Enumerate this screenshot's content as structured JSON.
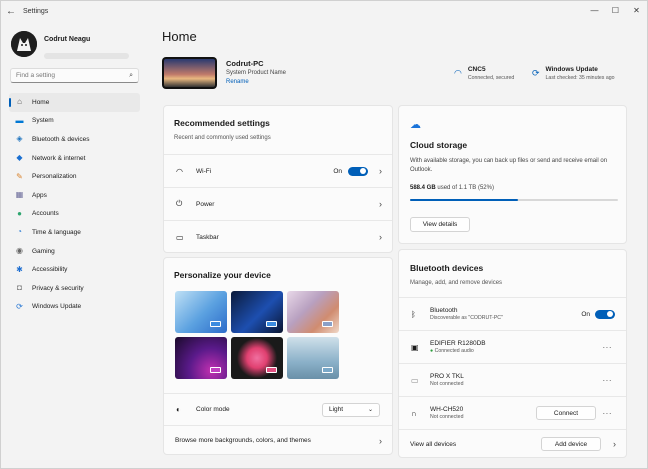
{
  "window": {
    "title": "Settings",
    "minimize": "—",
    "maximize": "☐",
    "close": "✕"
  },
  "profile": {
    "name": "Codrut Neagu"
  },
  "search": {
    "placeholder": "Find a setting"
  },
  "nav": [
    {
      "label": "Home",
      "icon": "home-icon",
      "glyph": "⌂",
      "color": "#555555"
    },
    {
      "label": "System",
      "icon": "system-icon",
      "glyph": "▬",
      "color": "#0078d4"
    },
    {
      "label": "Bluetooth & devices",
      "icon": "bluetooth-icon",
      "glyph": "◈",
      "color": "#1e73be"
    },
    {
      "label": "Network & internet",
      "icon": "network-icon",
      "glyph": "◆",
      "color": "#1a6fd1"
    },
    {
      "label": "Personalization",
      "icon": "personalization-icon",
      "glyph": "✎",
      "color": "#d9822b"
    },
    {
      "label": "Apps",
      "icon": "apps-icon",
      "glyph": "▦",
      "color": "#6b6b9a"
    },
    {
      "label": "Accounts",
      "icon": "accounts-icon",
      "glyph": "●",
      "color": "#2ea56f"
    },
    {
      "label": "Time & language",
      "icon": "time-language-icon",
      "glyph": "◔",
      "color": "#2b7cd3"
    },
    {
      "label": "Gaming",
      "icon": "gaming-icon",
      "glyph": "◉",
      "color": "#666666"
    },
    {
      "label": "Accessibility",
      "icon": "accessibility-icon",
      "glyph": "✱",
      "color": "#1f6fd1"
    },
    {
      "label": "Privacy & security",
      "icon": "privacy-icon",
      "glyph": "◘",
      "color": "#777777"
    },
    {
      "label": "Windows Update",
      "icon": "windows-update-icon",
      "glyph": "⟳",
      "color": "#1a6fd1"
    }
  ],
  "page": {
    "title": "Home"
  },
  "device": {
    "name": "Codrut-PC",
    "model": "System Product Name",
    "rename": "Rename"
  },
  "network": {
    "name": "CNC5",
    "status": "Connected, secured"
  },
  "update": {
    "title": "Windows Update",
    "status": "Last checked: 35 minutes ago"
  },
  "recommended": {
    "title": "Recommended settings",
    "subtitle": "Recent and commonly used settings",
    "items": [
      {
        "label": "Wi-Fi",
        "state": "On"
      },
      {
        "label": "Power"
      },
      {
        "label": "Taskbar"
      }
    ]
  },
  "cloud": {
    "title": "Cloud storage",
    "description": "With available storage, you can back up files or send and receive email on Outlook.",
    "used": "588.4 GB",
    "total_text": "used of 1.1 TB (52%)",
    "fraction": 0.52,
    "button": "View details"
  },
  "personalize": {
    "title": "Personalize your device",
    "color_mode_label": "Color mode",
    "color_mode_value": "Light",
    "browse": "Browse more backgrounds, colors, and themes"
  },
  "bluetooth": {
    "title": "Bluetooth devices",
    "subtitle": "Manage, add, and remove devices",
    "main": {
      "label": "Bluetooth",
      "sub": "Discoverable as \"CODRUT-PC\"",
      "state": "On"
    },
    "devices": [
      {
        "name": "EDIFIER R1280DB",
        "status": "Connected audio"
      },
      {
        "name": "PRO X TKL",
        "status": "Not connected"
      },
      {
        "name": "WH-CH520",
        "status": "Not connected",
        "action": "Connect"
      }
    ],
    "view_all": "View all devices",
    "add": "Add device"
  }
}
